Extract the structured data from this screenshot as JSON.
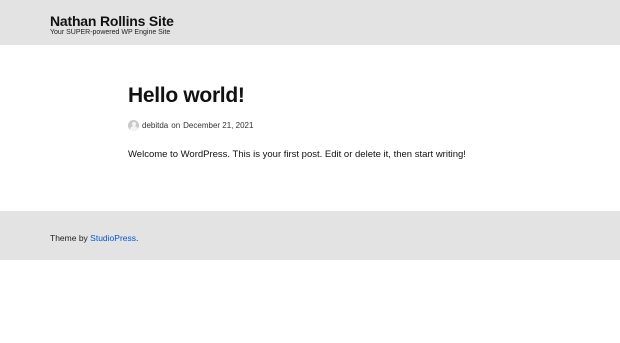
{
  "header": {
    "site_title": "Nathan Rollins Site",
    "site_description": "Your SUPER-powered WP Engine Site"
  },
  "post": {
    "title": "Hello world!",
    "author": "debitda",
    "on_text": "on",
    "date": "December 21, 2021",
    "content": "Welcome to WordPress. This is your first post. Edit or delete it, then start writing!"
  },
  "footer": {
    "theme_prefix": "Theme by",
    "theme_link": "StudioPress",
    "theme_suffix": "."
  },
  "colors": {
    "header_bg": "#e3e3e3",
    "footer_bg": "#e3e3e3",
    "link": "#0056d6"
  }
}
